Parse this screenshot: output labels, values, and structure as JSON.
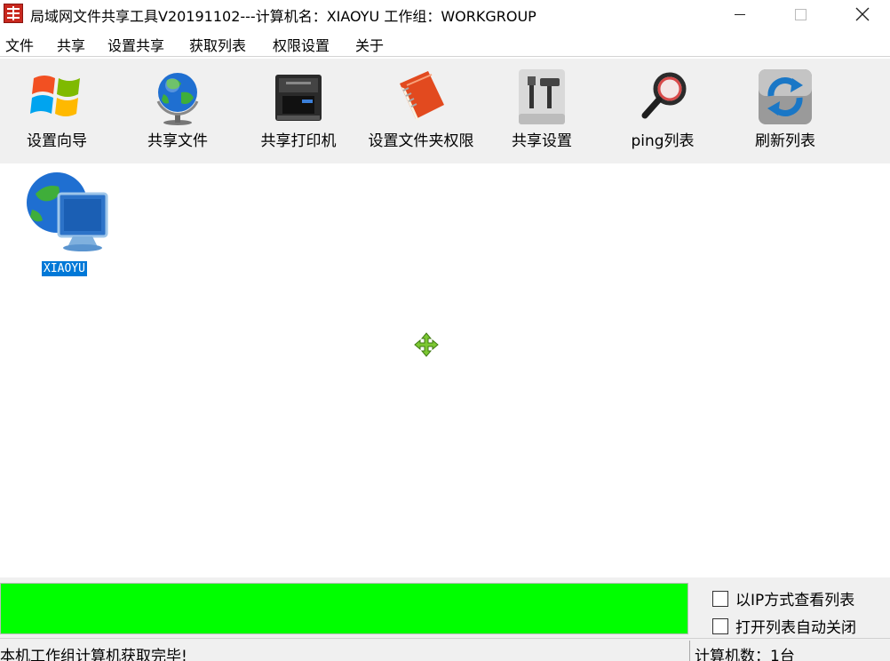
{
  "window": {
    "title": "局域网文件共享工具V20191102---计算机名：XIAOYU  工作组：WORKGROUP"
  },
  "menu": {
    "items": [
      "文件",
      "共享",
      "设置共享",
      "获取列表",
      "权限设置",
      "关于"
    ]
  },
  "toolbar": {
    "items": [
      "设置向导",
      "共享文件",
      "共享打印机",
      "设置文件夹权限",
      "共享设置",
      "ping列表",
      "刷新列表"
    ]
  },
  "hosts": [
    {
      "name": "XIAOYU",
      "selected": true
    }
  ],
  "progress": {
    "percent": 100,
    "color": "#00ff00"
  },
  "options": {
    "view_by_ip": {
      "label": "以IP方式查看列表",
      "checked": false
    },
    "auto_close": {
      "label": "打开列表自动关闭",
      "checked": false
    }
  },
  "status": {
    "message": "本机工作组计算机获取完毕!",
    "count": "计算机数：1台"
  },
  "colors": {
    "selection": "#0078d7",
    "toolbar_bg": "#f0f0f0"
  }
}
